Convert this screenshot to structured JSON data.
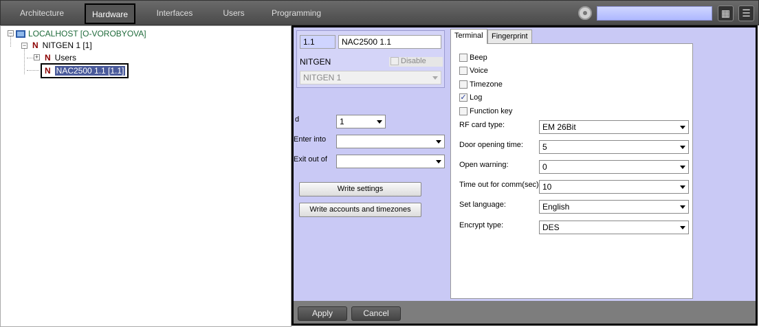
{
  "topnav": {
    "tabs": [
      "Architecture",
      "Hardware",
      "Interfaces",
      "Users",
      "Programming"
    ],
    "search_placeholder": ""
  },
  "tree": {
    "root": "LOCALHOST [O-VOROBYOVA]",
    "device": "NITGEN 1 [1]",
    "users": "Users",
    "selected": "NAC2500 1.1 [1.1]"
  },
  "panel": {
    "id_value": "1.1",
    "name_value": "NAC2500 1.1",
    "type_label": "NITGEN",
    "disable_label": "Disable",
    "parent_value": "NITGEN 1",
    "d_label": "d",
    "d_value": "1",
    "enter_label": "Enter into",
    "enter_value": "",
    "exit_label": "Exit out of",
    "exit_value": "",
    "write_settings": "Write settings",
    "write_accounts": "Write accounts and timezones",
    "tab_terminal": "Terminal",
    "tab_fingerprint": "Fingerprint",
    "cb_beep": "Beep",
    "cb_voice": "Voice",
    "cb_timezone": "Timezone",
    "cb_log": "Log",
    "cb_function": "Function key",
    "rf_label": "RF card type:",
    "rf_value": "EM 26Bit",
    "door_label": "Door opening time:",
    "door_value": "5",
    "open_label": "Open warning:",
    "open_value": "0",
    "timeout_label": "Time out for comm(sec):",
    "timeout_value": "10",
    "lang_label": "Set language:",
    "lang_value": "English",
    "enc_label": "Encrypt type:",
    "enc_value": "DES",
    "apply": "Apply",
    "cancel": "Cancel",
    "log_checked": true
  },
  "icons": {
    "check": "✓",
    "grid": "▦",
    "menu": "☰",
    "n": "N",
    "plus": "+",
    "minus": "−"
  },
  "colors": {
    "panel_bg": "#c9c9f5",
    "selection_bg": "#4a5a9a",
    "topbar": "#5a5a5a"
  }
}
